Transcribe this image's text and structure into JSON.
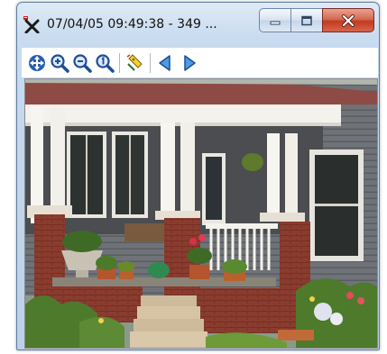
{
  "window": {
    "title": "07/04/05 09:49:38 - 349 ..."
  },
  "icons": {
    "app": "camera-crossed-icon",
    "minimize": "minimize-icon",
    "maximize": "maximize-icon",
    "close": "close-icon"
  },
  "toolbar": {
    "tools": [
      "pan-icon",
      "zoom-in-icon",
      "zoom-out-icon",
      "zoom-actual-size-icon",
      "annotate-icon",
      "previous-icon",
      "next-icon"
    ]
  },
  "colors": {
    "titlebar": "#c8dbef",
    "close_button": "#c23a22",
    "house_siding": "#6f7378",
    "porch_white": "#f4f2ec",
    "brick": "#8a3c2e",
    "foliage": "#4e7a2c"
  }
}
